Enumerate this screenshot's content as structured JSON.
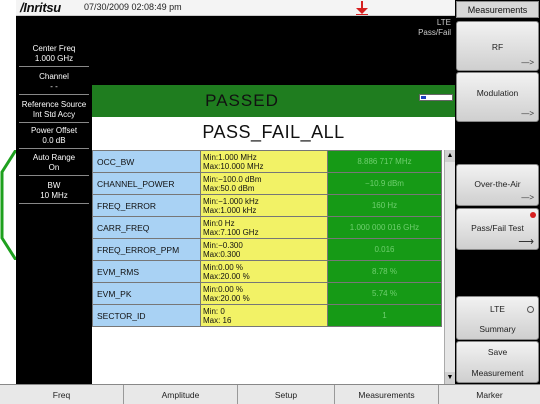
{
  "status_bar": {
    "brand": "/Inritsu",
    "datetime": "07/30/2009 02:08:49 pm"
  },
  "left_panel": {
    "center_freq": {
      "label": "Center Freq",
      "value": "1.000 GHz"
    },
    "channel": {
      "label": "Channel",
      "value": "- -"
    },
    "reference_source": {
      "label": "Reference Source",
      "value": "Int Std Accy"
    },
    "power_offset": {
      "label": "Power Offset",
      "value": "0.0 dB"
    },
    "auto_range": {
      "label": "Auto Range",
      "value": "On"
    },
    "bw": {
      "label": "BW",
      "value": "10 MHz"
    }
  },
  "main": {
    "mode_line1": "LTE",
    "mode_line2": "Pass/Fail",
    "result": "PASSED",
    "test_name": "PASS_FAIL_ALL",
    "meter_level_fraction": 0.15,
    "rows": [
      {
        "name": "OCC_BW",
        "min": "Min:1.000 MHz",
        "max": "Max:10.000 MHz",
        "value": "8.886 717 MHz"
      },
      {
        "name": "CHANNEL_POWER",
        "min": "Min:−100.0 dBm",
        "max": "Max:50.0 dBm",
        "value": "−10.9 dBm"
      },
      {
        "name": "FREQ_ERROR",
        "min": "Min:−1.000 kHz",
        "max": "Max:1.000 kHz",
        "value": "160 Hz"
      },
      {
        "name": "CARR_FREQ",
        "min": "Min:0 Hz",
        "max": "Max:7.100 GHz",
        "value": "1.000 000 016 GHz"
      },
      {
        "name": "FREQ_ERROR_PPM",
        "min": "Min:−0.300",
        "max": "Max:0.300",
        "value": "0.016"
      },
      {
        "name": "EVM_RMS",
        "min": "Min:0.00 %",
        "max": "Max:20.00 %",
        "value": "8.78 %"
      },
      {
        "name": "EVM_PK",
        "min": "Min:0.00 %",
        "max": "Max:20.00 %",
        "value": "5.74 %"
      },
      {
        "name": "SECTOR_ID",
        "min": "Min:  0",
        "max": "Max: 16",
        "value": "1"
      }
    ]
  },
  "softkeys": {
    "header": "Measurements",
    "rf": "RF",
    "modulation": "Modulation",
    "over_the_air": "Over-the-Air",
    "pass_fail_test": "Pass/Fail Test",
    "lte": "LTE",
    "summary": "Summary",
    "save": "Save",
    "measurement": "Measurement"
  },
  "function_keys": [
    "Freq",
    "Amplitude",
    "Setup",
    "Measurements",
    "Marker"
  ],
  "colors": {
    "pass_green": "#1f7d1f",
    "name_blue": "#a9d2f4",
    "limit_yellow": "#f2f266",
    "value_green": "#169a16",
    "alert_red": "#d62020"
  }
}
